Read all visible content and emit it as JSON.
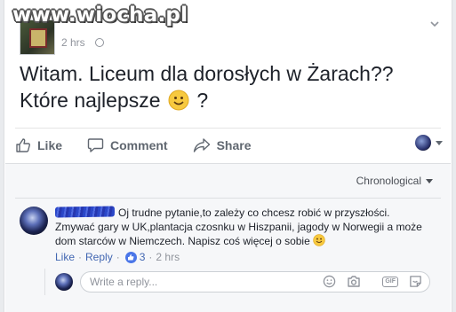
{
  "watermark": "www.wiocha.pl",
  "post": {
    "time": "2 hrs",
    "text_line1": "Witam. Liceum dla dorosłych w Żarach??",
    "text_line2_before": "Które najlepsze",
    "text_line2_after": "?"
  },
  "actions": {
    "like": "Like",
    "comment": "Comment",
    "share": "Share"
  },
  "comments": {
    "sort_label": "Chronological",
    "items": [
      {
        "text_line1": "Oj trudne pytanie,to zależy co chcesz robić w przyszłości.",
        "text_line2": "Zmywać gary w UK,plantacja czosnku w Hiszpanii, jagody w Norwegii a może",
        "text_line3": "dom starców w Niemczech. Napisz coś więcej o sobie",
        "like_label": "Like",
        "reply_label": "Reply",
        "reaction_count": "3",
        "time": "2 hrs"
      }
    ],
    "reply_placeholder": "Write a reply..."
  },
  "colors": {
    "link": "#4267b2",
    "muted": "#90949c",
    "like_badge": "#4a76e8"
  }
}
